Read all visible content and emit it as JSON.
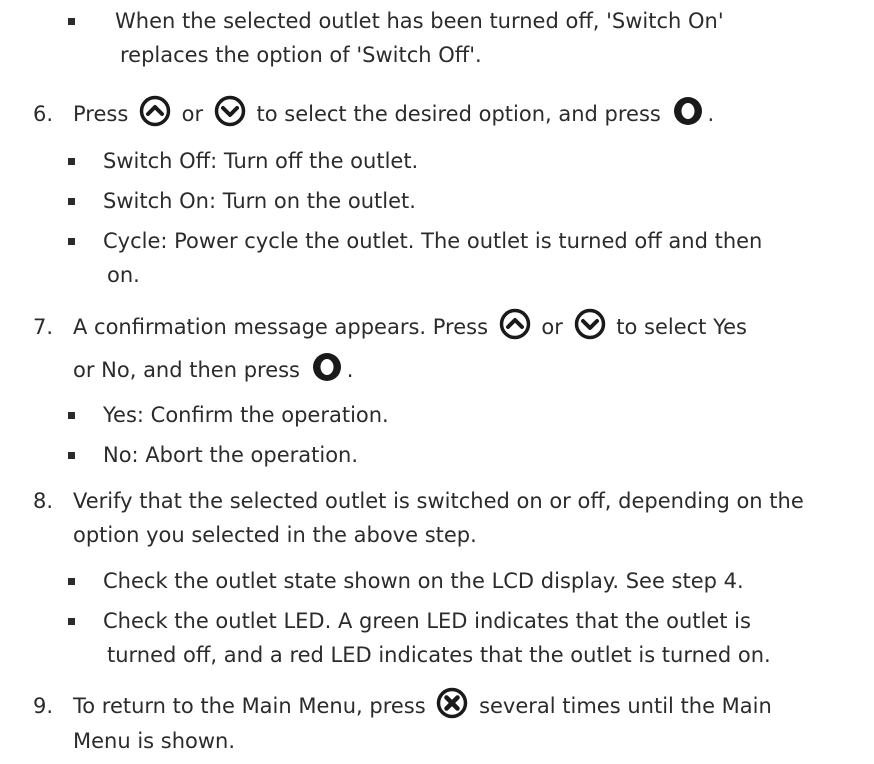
{
  "bullets_top": [
    "When the selected outlet has been turned off, 'Switch On'",
    "replaces the option of 'Switch Off'."
  ],
  "step6": {
    "num": "6.",
    "t1": "Press",
    "t2": "or",
    "t3": "to select the desired option, and press",
    "t4": ".",
    "items": [
      "Switch Off: Turn off the outlet.",
      "Switch On: Turn on the outlet.",
      "Cycle: Power cycle the outlet. The outlet is turned off and then",
      "on."
    ]
  },
  "step7": {
    "num": "7.",
    "t1": "A confirmation message appears. Press",
    "t2": "or",
    "t3": "to select Yes",
    "t4": "or No, and then press",
    "t5": ".",
    "items": [
      "Yes: Confirm the operation.",
      "No: Abort the operation."
    ]
  },
  "step8": {
    "num": "8.",
    "l1": "Verify that the selected outlet is switched on or off, depending on the",
    "l2": "option you selected in the above step.",
    "items": [
      "Check the outlet state shown on the LCD display. See step 4.",
      "Check the outlet LED. A green LED indicates that the outlet is",
      "turned off, and a red LED indicates that the outlet is turned on."
    ]
  },
  "step9": {
    "num": "9.",
    "t1": "To return to the Main Menu, press",
    "t2": "several times until the Main",
    "l2": "Menu is shown."
  },
  "icons": [
    "up-button-icon",
    "down-button-icon",
    "ok-button-icon",
    "cancel-button-icon"
  ],
  "colors": {
    "text": "#2b2b2b",
    "icon": "#1a1a1a"
  }
}
